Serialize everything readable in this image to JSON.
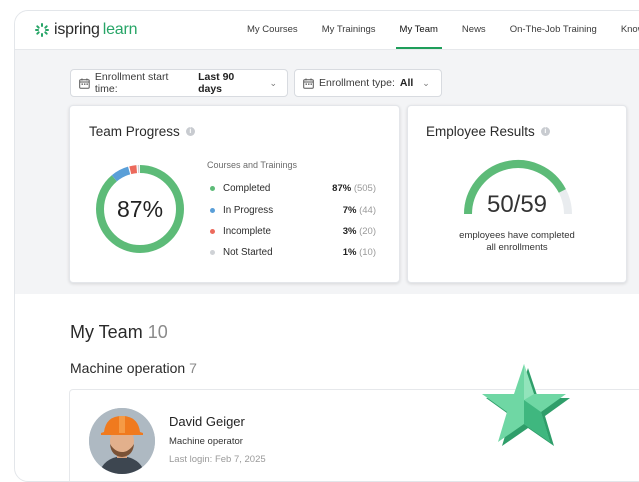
{
  "app": {
    "logo_brand": "ispring",
    "logo_product": "learn",
    "accent": "#1f9e5a"
  },
  "nav": {
    "items": [
      {
        "label": "My Courses",
        "active": false
      },
      {
        "label": "My Trainings",
        "active": false
      },
      {
        "label": "My Team",
        "active": true
      },
      {
        "label": "News",
        "active": false
      },
      {
        "label": "On-The-Job Training",
        "active": false
      },
      {
        "label": "Knowl",
        "active": false
      }
    ]
  },
  "filters": {
    "start_time": {
      "label": "Enrollment start time:",
      "value": "Last 90 days"
    },
    "type": {
      "label": "Enrollment type:",
      "value": "All"
    }
  },
  "team_progress": {
    "title": "Team Progress",
    "percent_label": "87%",
    "legend_title": "Courses and Trainings",
    "items": [
      {
        "label": "Completed",
        "percent": "87%",
        "count": "(505)",
        "color": "#5dbb78"
      },
      {
        "label": "In Progress",
        "percent": "7%",
        "count": "(44)",
        "color": "#5a9fd8"
      },
      {
        "label": "Incomplete",
        "percent": "3%",
        "count": "(20)",
        "color": "#ec6a5c"
      },
      {
        "label": "Not Started",
        "percent": "1%",
        "count": "(10)",
        "color": "#cfd2d6"
      }
    ]
  },
  "employee_results": {
    "title": "Employee Results",
    "value": "50/59",
    "completed": 50,
    "total": 59,
    "caption_line1": "employees have completed",
    "caption_line2": "all enrollments"
  },
  "team": {
    "title": "My Team",
    "count": "10",
    "group": {
      "name": "Machine operation",
      "count": "7"
    },
    "employee": {
      "name": "David Geiger",
      "role": "Machine operator",
      "last_login": "Last login: Feb 7, 2025"
    }
  }
}
